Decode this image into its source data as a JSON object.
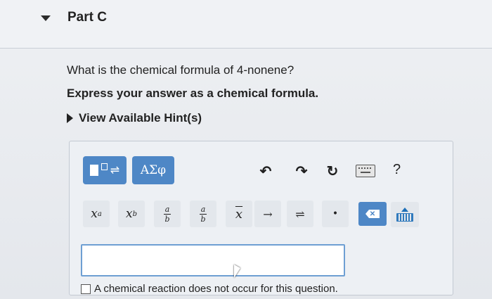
{
  "header": {
    "title": "Part C"
  },
  "question": {
    "text": "What is the chemical formula of 4-nonene?",
    "instruction": "Express your answer as a chemical formula."
  },
  "hints": {
    "label": "View Available Hint(s)"
  },
  "toolbar": {
    "greek_label": "ΑΣφ",
    "undo_icon": "undo-icon",
    "redo_icon": "redo-icon",
    "reset_icon": "reset-icon",
    "keyboard_icon": "keyboard-icon",
    "help_label": "?"
  },
  "symbols": {
    "superscript": {
      "base": "x",
      "exp": "a"
    },
    "subscript": {
      "base": "x",
      "idx": "b"
    },
    "fraction": {
      "num": "a",
      "den": "b"
    },
    "boxed_fraction": {
      "num": "a",
      "den": "b"
    },
    "vector": "x",
    "arrow": "→",
    "equilibrium": "⇌",
    "dot": "•"
  },
  "answer": {
    "value": "",
    "placeholder": ""
  },
  "no_reaction": {
    "label": "A chemical reaction does not occur for this question."
  },
  "colors": {
    "accent": "#4e87c6",
    "input_border": "#6e9fd3"
  }
}
